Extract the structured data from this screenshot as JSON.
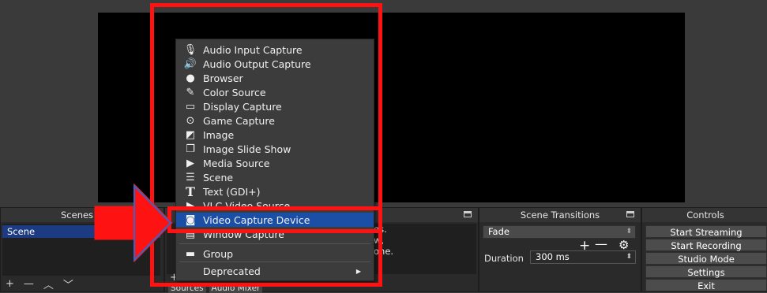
{
  "menu": {
    "items": [
      {
        "label": "Audio Input Capture",
        "icon": "microphone-icon"
      },
      {
        "label": "Audio Output Capture",
        "icon": "speaker-icon"
      },
      {
        "label": "Browser",
        "icon": "globe-icon"
      },
      {
        "label": "Color Source",
        "icon": "brush-icon"
      },
      {
        "label": "Display Capture",
        "icon": "monitor-icon"
      },
      {
        "label": "Game Capture",
        "icon": "gamepad-icon"
      },
      {
        "label": "Image",
        "icon": "image-icon"
      },
      {
        "label": "Image Slide Show",
        "icon": "slideshow-icon"
      },
      {
        "label": "Media Source",
        "icon": "play-icon"
      },
      {
        "label": "Scene",
        "icon": "list-icon"
      },
      {
        "label": "Text (GDI+)",
        "icon": "text-icon"
      },
      {
        "label": "VLC Video Source",
        "icon": "play-icon"
      },
      {
        "label": "Video Capture Device",
        "icon": "camera-icon"
      },
      {
        "label": "Window Capture",
        "icon": "window-icon"
      }
    ],
    "group_label": "Group",
    "deprecated_label": "Deprecated",
    "highlight_color": "#1b4fa6"
  },
  "scenes": {
    "title": "Scenes",
    "items": [
      "Scene"
    ]
  },
  "sources": {
    "tab_sources": "Sources",
    "tab_audio_mixer": "Audio Mixer",
    "partial_text": [
      "es.",
      "w,",
      "one."
    ]
  },
  "transitions": {
    "title": "Scene Transitions",
    "selected": "Fade",
    "duration_label": "Duration",
    "duration_value": "300 ms"
  },
  "controls": {
    "title": "Controls",
    "buttons": [
      "Start Streaming",
      "Start Recording",
      "Studio Mode",
      "Settings",
      "Exit"
    ]
  },
  "annotation": {
    "color": "#ff1212"
  }
}
